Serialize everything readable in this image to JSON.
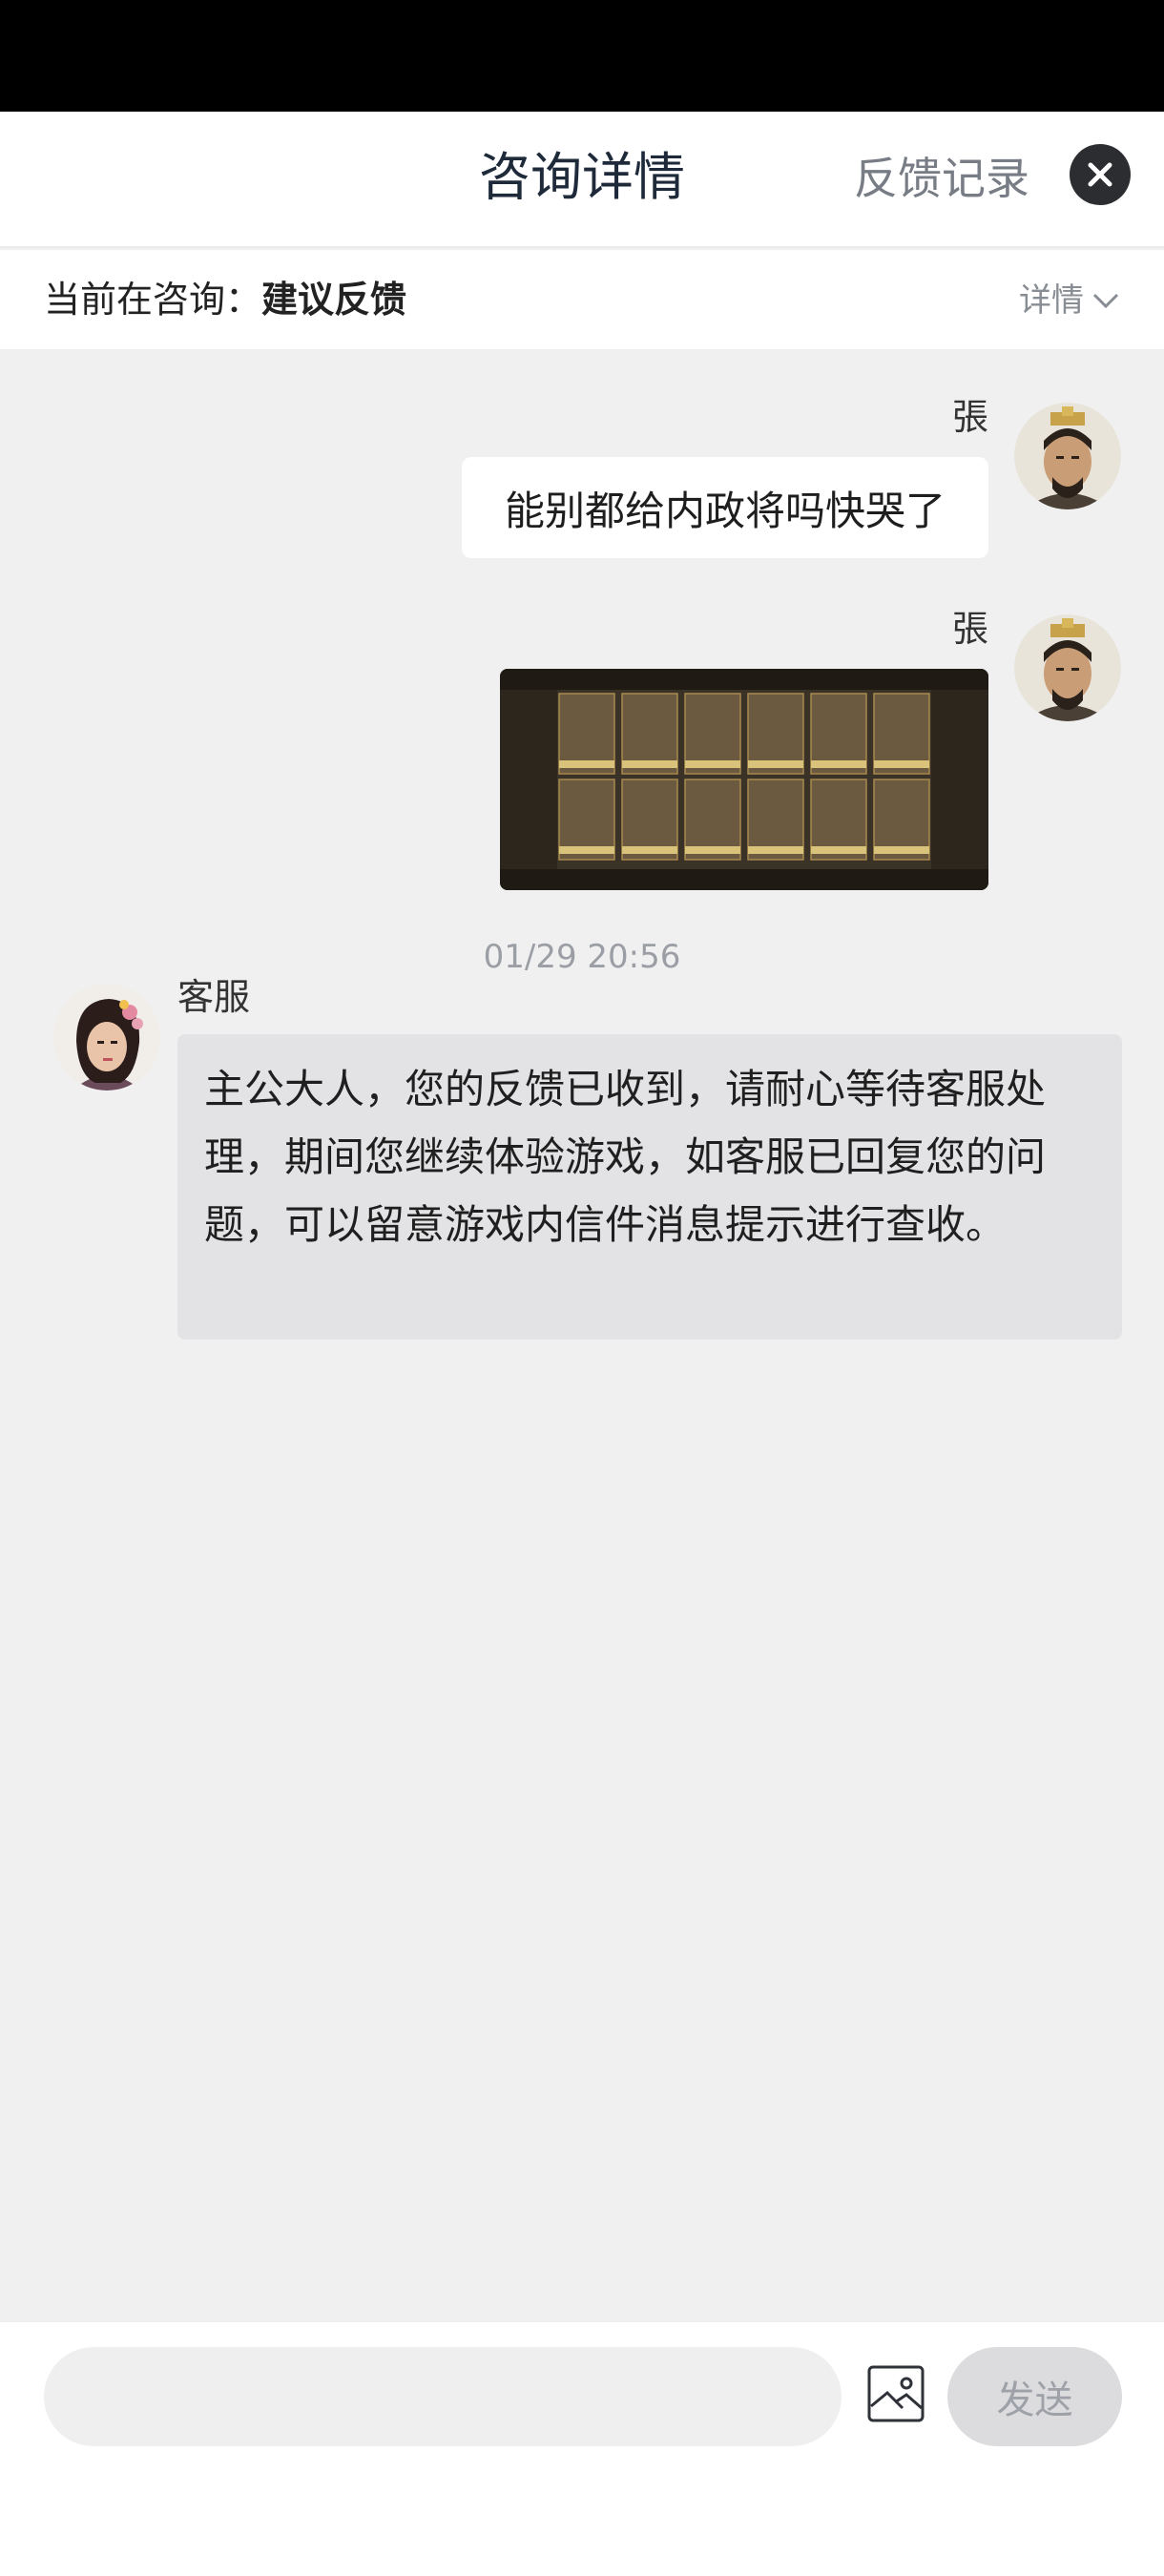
{
  "header": {
    "title": "咨询详情",
    "feedback_link": "反馈记录",
    "close_icon": "close-icon"
  },
  "consult": {
    "label": "当前在咨询：",
    "topic": "建议反馈",
    "details": "详情"
  },
  "messages": [
    {
      "sender": "張",
      "type": "text",
      "text": "能别都给内政将吗快哭了"
    },
    {
      "sender": "張",
      "type": "image"
    }
  ],
  "timestamp": "01/29 20:56",
  "support": {
    "sender": "客服",
    "text": "主公大人，您的反馈已收到，请耐心等待客服处理，期间您继续体验游戏，如客服已回复您的问题，可以留意游戏内信件消息提示进行查收。"
  },
  "footer": {
    "input_value": "",
    "send_label": "发送"
  },
  "colors": {
    "header_bg": "#ffffff",
    "chat_bg": "#f0f0f1",
    "cs_bubble": "#e3e3e5",
    "send_button": "#dcdcde"
  }
}
